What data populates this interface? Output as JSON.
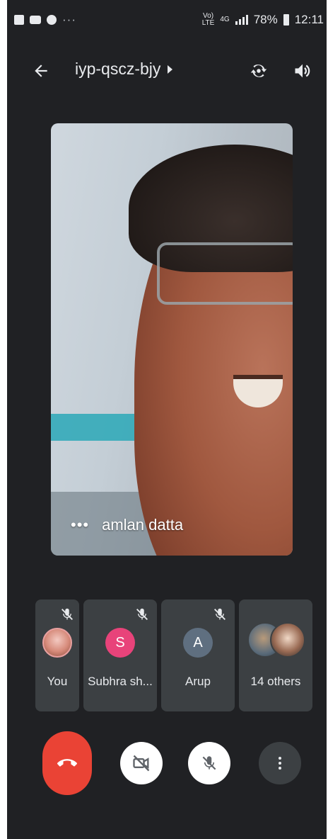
{
  "status_bar": {
    "notification_icons": [
      "gallery-icon",
      "youtube-icon",
      "facebook-icon"
    ],
    "overflow": "···",
    "network_top": "Vo)",
    "network_bottom": "LTE",
    "data_type_top": "4G",
    "battery": "78%",
    "time": "12:11"
  },
  "header": {
    "meeting_code": "iyp-qscz-bjy"
  },
  "main_video": {
    "participant_name": "amlan datta",
    "more_label": "•••"
  },
  "tiles": [
    {
      "name": "You",
      "avatar_type": "photo",
      "muted": true
    },
    {
      "name": "Subhra sh...",
      "avatar_letter": "S",
      "avatar_color": "#e8437a",
      "muted": true
    },
    {
      "name": "Arup",
      "avatar_letter": "A",
      "avatar_color": "#5f6f80",
      "muted": true
    },
    {
      "name": "14 others",
      "avatar_type": "group"
    }
  ],
  "colors": {
    "background": "#202124",
    "tile": "#3c4043",
    "end_call": "#ea4335",
    "control_light": "#ffffff"
  },
  "controls": {
    "end_call_icon": "call-end-icon",
    "camera_icon": "video-off-icon",
    "mic_icon": "mic-off-icon",
    "more_icon": "more-vert-icon"
  }
}
